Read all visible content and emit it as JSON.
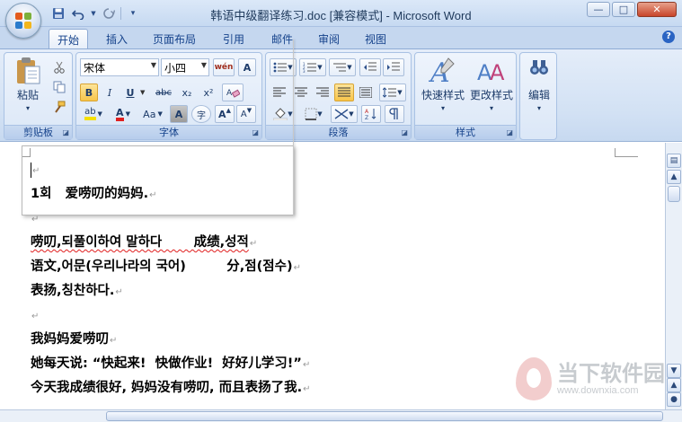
{
  "window": {
    "title": "韩语中级翻译练习.doc [兼容模式] - Microsoft Word",
    "controls": {
      "minimize": "—",
      "maximize": "□",
      "close": "✕"
    }
  },
  "qat": {
    "icons": [
      "save-icon",
      "undo-icon",
      "redo-icon",
      "customize-icon"
    ]
  },
  "tabs": [
    "开始",
    "插入",
    "页面布局",
    "引用",
    "邮件",
    "审阅",
    "视图"
  ],
  "active_tab": "开始",
  "help_label": "?",
  "ribbon": {
    "clipboard": {
      "label": "剪贴板",
      "paste_label": "粘贴"
    },
    "font": {
      "label": "字体",
      "font_name": "宋体",
      "font_size": "小四",
      "wen_label": "wén",
      "bold": "B",
      "italic": "I",
      "underline": "U",
      "strike": "abc",
      "subscript": "x₂",
      "superscript": "x²",
      "case": "Aa",
      "char_shade": "A",
      "enclose": "字",
      "grow": "A",
      "shrink": "A",
      "border_a": "A",
      "highlight": "ab",
      "font_color": "A",
      "font_color_hex": "#e02020",
      "highlight_hex": "#f5e000"
    },
    "paragraph": {
      "label": "段落"
    },
    "styles": {
      "label": "样式",
      "quick_styles": "快速样式",
      "change_styles": "更改样式"
    },
    "editing": {
      "label": "编辑"
    }
  },
  "document": {
    "lines": [
      "",
      "1회   爱唠叨的妈妈.",
      "",
      "唠叨,되풀이하여 말하다       成绩,성적",
      "语文,어문(우리나라의 국어)         分,점(점수)",
      "表扬,칭찬하다.",
      "",
      "我妈妈爱唠叨",
      "她每天说: “快起来!  快做作业!  好好儿学习!”",
      "今天我成绩很好, 妈妈没有唠叨, 而且表扬了我."
    ],
    "paragraph_mark": "↵"
  },
  "watermark": {
    "name": "当下软件园",
    "url": "www.downxia.com"
  }
}
